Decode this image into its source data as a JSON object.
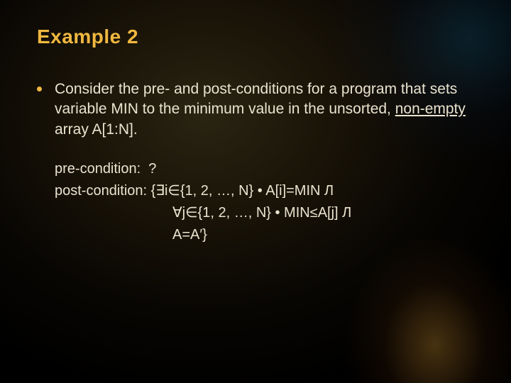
{
  "title": "Example 2",
  "bullet": {
    "pre": "Consider the pre- and post-conditions for a program that sets variable MIN to the minimum value in the unsorted, ",
    "underlined": "non-empty",
    "post": " array A[1:N]."
  },
  "conditions": {
    "pre_label": "pre-condition:  ",
    "pre_value": "?",
    "post_label": "post-condition: ",
    "post_line1": "{∃i∈{1, 2, …, N} • A[i]=MIN Л",
    "post_line2": " ∀j∈{1, 2, …, N} • MIN≤A[j] Л",
    "post_line3": " A=A′}"
  }
}
